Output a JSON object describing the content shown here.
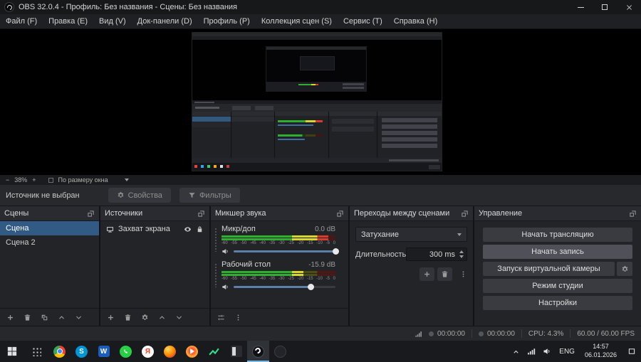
{
  "window": {
    "title": "OBS 32.0.4 - Профиль: Без названия - Сцены: Без названия"
  },
  "menu": {
    "items": [
      "Файл (F)",
      "Правка (E)",
      "Вид (V)",
      "Док-панели (D)",
      "Профиль (P)",
      "Коллекция сцен (S)",
      "Сервис (T)",
      "Справка (H)"
    ]
  },
  "preview_toolbar": {
    "zoom_out": "−",
    "zoom_level": "38%",
    "zoom_in": "+",
    "fit_label": "По размеру окна"
  },
  "source_toolbar": {
    "status": "Источник не выбран",
    "properties": "Свойства",
    "filters": "Фильтры"
  },
  "docks": {
    "scenes": {
      "title": "Сцены",
      "items": [
        {
          "label": "Сцена",
          "selected": true
        },
        {
          "label": "Сцена 2",
          "selected": false
        }
      ]
    },
    "sources": {
      "title": "Источники",
      "items": [
        {
          "label": "Захват экрана"
        }
      ]
    },
    "mixer": {
      "title": "Микшер звука",
      "ticks": [
        "-60",
        "-55",
        "-50",
        "-45",
        "-40",
        "-35",
        "-30",
        "-25",
        "-20",
        "-15",
        "-10",
        "-5",
        "0"
      ],
      "channels": [
        {
          "name": "Микр/доп",
          "db": "0.0 dB",
          "level_pct": 94,
          "fader_pct": 100
        },
        {
          "name": "Рабочий стол",
          "db": "-15.9 dB",
          "level_pct": 72,
          "fader_pct": 76
        }
      ]
    },
    "transitions": {
      "title": "Переходы между сценами",
      "current": "Затухание",
      "duration_label": "Длительность",
      "duration_value": "300 ms"
    },
    "controls": {
      "title": "Управление",
      "stream": "Начать трансляцию",
      "record": "Начать запись",
      "vcam": "Запуск виртуальной камеры",
      "studio": "Режим студии",
      "settings": "Настройки"
    }
  },
  "status_bar": {
    "stream_time": "00:00:00",
    "record_time": "00:00:00",
    "cpu": "CPU: 4.3%",
    "fps": "60.00 / 60.00 FPS"
  },
  "taskbar": {
    "lang": "ENG",
    "time": "14:57",
    "date": "06.01.2026",
    "glyphs": {
      "skype": "S",
      "word": "W",
      "yandex": "Я"
    }
  }
}
